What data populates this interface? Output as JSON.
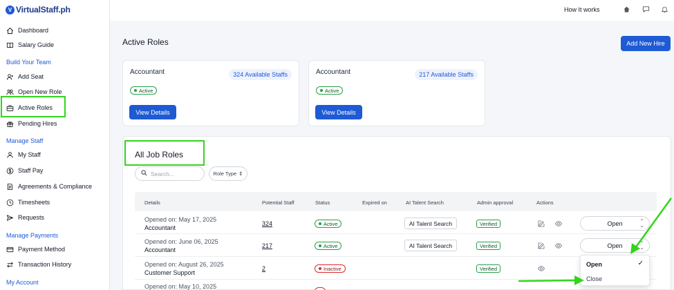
{
  "brand": {
    "logo_mark": "V",
    "name": "VirtualStaff.ph"
  },
  "sidebar": {
    "top_items": [
      {
        "label": "Dashboard",
        "icon": "home-icon"
      },
      {
        "label": "Salary Guide",
        "icon": "book-icon"
      }
    ],
    "sections": [
      {
        "title": "Build Your Team",
        "items": [
          {
            "label": "Add Seat",
            "icon": "user-plus-icon"
          },
          {
            "label": "Open New Role",
            "icon": "users-icon"
          },
          {
            "label": "Active Roles",
            "icon": "briefcase-icon",
            "highlighted": true
          },
          {
            "label": "Pending Hires",
            "icon": "gift-icon"
          }
        ]
      },
      {
        "title": "Manage Staff",
        "items": [
          {
            "label": "My Staff",
            "icon": "person-icon"
          },
          {
            "label": "Staff Pay",
            "icon": "dollar-icon"
          },
          {
            "label": "Agreements & Compliance",
            "icon": "document-icon"
          },
          {
            "label": "Timesheets",
            "icon": "clock-icon"
          },
          {
            "label": "Requests",
            "icon": "send-icon"
          }
        ]
      },
      {
        "title": "Manage Payments",
        "items": [
          {
            "label": "Payment Method",
            "icon": "credit-card-icon"
          },
          {
            "label": "Transaction History",
            "icon": "arrows-icon"
          }
        ]
      },
      {
        "title": "My Account",
        "items": []
      }
    ]
  },
  "topbar": {
    "how_it_works": "How It works",
    "icons": [
      "home-icon",
      "chat-icon",
      "bell-icon"
    ]
  },
  "main": {
    "title": "Active Roles",
    "add_new_hire": "Add New Hire",
    "cards": [
      {
        "role": "Accountant",
        "available": "324 Available Staffs",
        "status": "Active",
        "button": "View Details"
      },
      {
        "role": "Accountant",
        "available": "217 Available Staffs",
        "status": "Active",
        "button": "View Details"
      }
    ]
  },
  "job_roles": {
    "title": "All Job Roles",
    "search_placeholder": "Search...",
    "role_type_label": "Role Type",
    "columns": {
      "details": "Details",
      "potential_staff": "Potential Staff",
      "status": "Status",
      "expired_on": "Expired on",
      "ai_talent_search": "AI Talent Search",
      "admin_approval": "Admin approval",
      "actions": "Actions"
    },
    "rows": [
      {
        "opened": "Opened on: May 17, 2025",
        "role": "Accountant",
        "potential": "324",
        "status": "Active",
        "status_kind": "active",
        "ai": "AI Talent Search",
        "approval": "Verified",
        "edit": true,
        "view": true,
        "select": "Open"
      },
      {
        "opened": "Opened on: June 06, 2025",
        "role": "Accountant",
        "potential": "217",
        "status": "Active",
        "status_kind": "active",
        "ai": "AI Talent Search",
        "approval": "Verified",
        "edit": true,
        "view": true,
        "select": "Open"
      },
      {
        "opened": "Opened on: August 26, 2025",
        "role": "Customer Support",
        "potential": "2",
        "status": "Inactive",
        "status_kind": "inactive",
        "ai": "",
        "approval": "Verified",
        "edit": false,
        "view": true,
        "select": ""
      },
      {
        "opened": "Opened on: May 10, 2025",
        "role": "",
        "potential": "",
        "status": "",
        "status_kind": "inactive",
        "ai": "",
        "approval": "",
        "edit": false,
        "view": false,
        "select": ""
      }
    ],
    "dropdown": {
      "options": [
        "Open",
        "Close"
      ],
      "selected": "Open"
    }
  },
  "colors": {
    "brand_blue": "#1e5ad4",
    "highlight_green": "#33d41d",
    "active_green": "#22a046",
    "inactive_red": "#dc2626"
  }
}
